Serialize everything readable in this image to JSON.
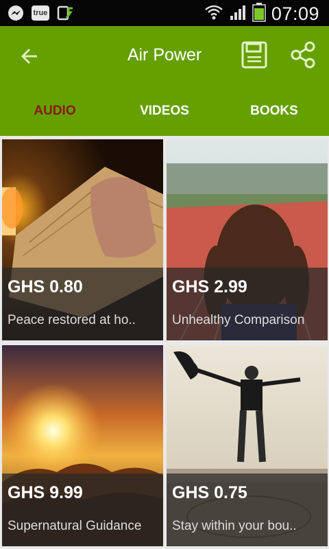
{
  "status_bar": {
    "icons": [
      "messenger-icon",
      "true-app-icon",
      "screen-update-icon",
      "wifi-icon",
      "signal-icon",
      "battery-icon"
    ],
    "true_label": "true",
    "time": "07:09"
  },
  "app_bar": {
    "title": "Air Power",
    "color": "#65a000"
  },
  "tabs": [
    {
      "label": "AUDIO",
      "active": true
    },
    {
      "label": "VIDEOS",
      "active": false
    },
    {
      "label": "BOOKS",
      "active": false
    }
  ],
  "items": [
    {
      "price": "GHS 0.80",
      "title": "Peace restored at ho.."
    },
    {
      "price": "GHS 2.99",
      "title": "Unhealthy Comparison"
    },
    {
      "price": "GHS 9.99",
      "title": "Supernatural Guidance"
    },
    {
      "price": "GHS 0.75",
      "title": "Stay within your bou.."
    }
  ]
}
